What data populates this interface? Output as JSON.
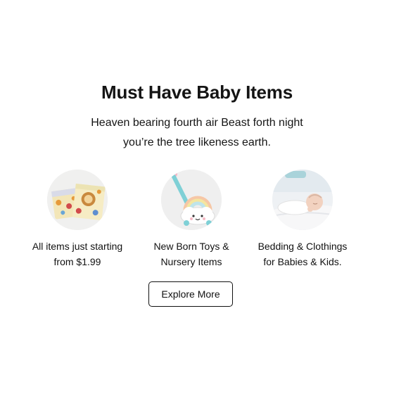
{
  "section": {
    "title": "Must Have Baby Items",
    "subtitle_line1": "Heaven bearing fourth air Beast forth night",
    "subtitle_line2": "you’re the tree likeness earth."
  },
  "features": [
    {
      "icon": "diaper-packs-image",
      "line1": "All items just starting",
      "line2": "from $1.99"
    },
    {
      "icon": "cloud-push-toy-image",
      "line1": "New Born Toys &",
      "line2": "Nursery Items"
    },
    {
      "icon": "sleeping-baby-image",
      "line1": "Bedding & Clothings",
      "line2": "for Babies & Kids."
    }
  ],
  "cta": {
    "label": "Explore More"
  },
  "colors": {
    "circle_bg": "#efefef",
    "text": "#111111",
    "button_border": "#111111"
  }
}
